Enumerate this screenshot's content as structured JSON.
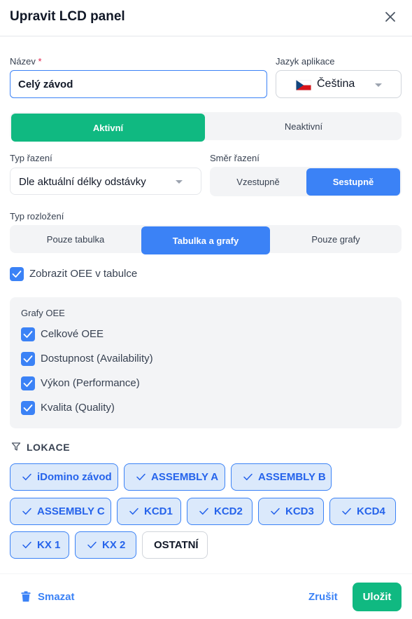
{
  "dialog": {
    "title": "Upravit LCD panel"
  },
  "name_field": {
    "label": "Název",
    "required_mark": "*",
    "value": "Celý závod"
  },
  "language": {
    "label": "Jazyk aplikace",
    "selected": "Čeština",
    "flag": "czech-flag-icon"
  },
  "status": {
    "options": [
      "Aktivní",
      "Neaktivní"
    ],
    "selected": "Aktivní",
    "active_color": "#10b981"
  },
  "sort_type": {
    "label": "Typ řazení",
    "selected": "Dle aktuální délky odstávky"
  },
  "sort_direction": {
    "label": "Směr řazení",
    "options": [
      "Vzestupně",
      "Sestupně"
    ],
    "selected": "Sestupně",
    "active_color": "#3b82f6"
  },
  "layout_type": {
    "label": "Typ rozložení",
    "options": [
      "Pouze tabulka",
      "Tabulka a grafy",
      "Pouze grafy"
    ],
    "selected": "Tabulka a grafy"
  },
  "show_oee": {
    "label": "Zobrazit OEE v tabulce",
    "checked": true
  },
  "oee_charts": {
    "title": "Grafy OEE",
    "items": [
      {
        "label": "Celkové OEE",
        "checked": true
      },
      {
        "label": "Dostupnost (Availability)",
        "checked": true
      },
      {
        "label": "Výkon (Performance)",
        "checked": true
      },
      {
        "label": "Kvalita (Quality)",
        "checked": true
      }
    ]
  },
  "locations": {
    "title": "LOKACE",
    "icon": "filter-icon",
    "chips": [
      {
        "label": "iDomino závod",
        "selected": true
      },
      {
        "label": "ASSEMBLY A",
        "selected": true
      },
      {
        "label": "ASSEMBLY B",
        "selected": true
      },
      {
        "label": "ASSEMBLY C",
        "selected": true
      },
      {
        "label": "KCD1",
        "selected": true
      },
      {
        "label": "KCD2",
        "selected": true
      },
      {
        "label": "KCD3",
        "selected": true
      },
      {
        "label": "KCD4",
        "selected": true
      },
      {
        "label": "KX 1",
        "selected": true
      },
      {
        "label": "KX 2",
        "selected": true
      },
      {
        "label": "OSTATNÍ",
        "selected": false
      }
    ]
  },
  "footer": {
    "delete_label": "Smazat",
    "cancel_label": "Zrušit",
    "save_label": "Uložit"
  },
  "colors": {
    "primary": "#3b82f6",
    "success": "#10b981",
    "chip_bg": "#dbe9fb"
  }
}
